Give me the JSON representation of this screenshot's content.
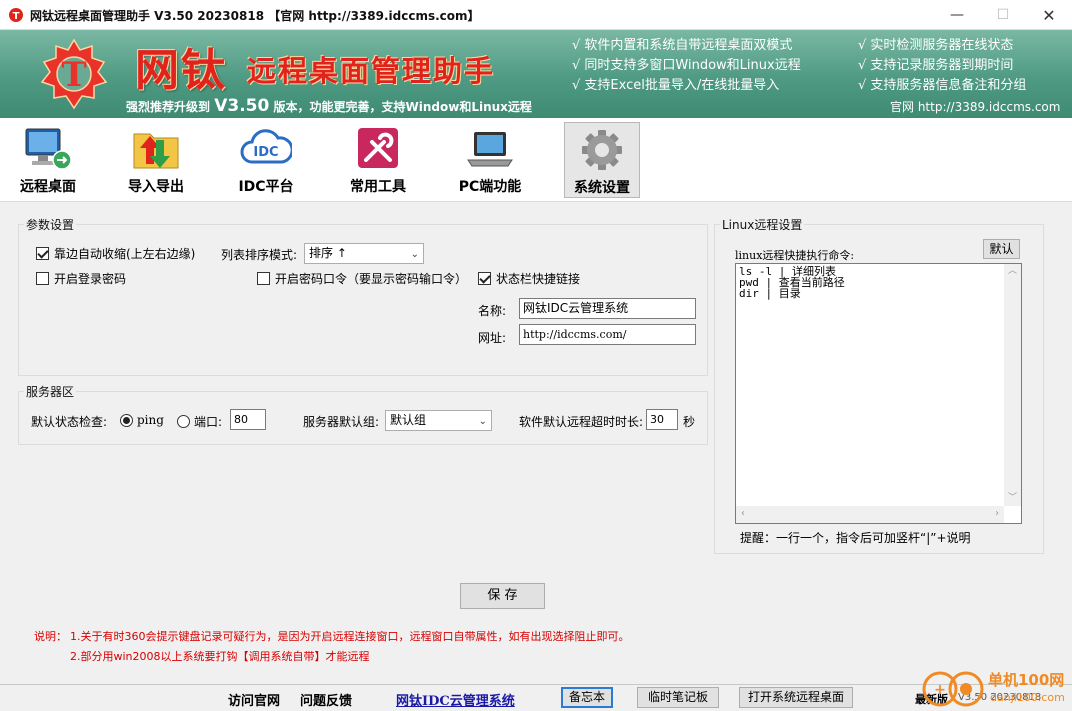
{
  "window": {
    "title": "网钛远程桌面管理助手 V3.50 20230818 【官网 http://3389.idccms.com】"
  },
  "banner": {
    "title_big": "网钛",
    "title_sub": "远程桌面管理助手",
    "promo_prefix": "强烈推荐升级到",
    "promo_version": "V3.50",
    "promo_suffix": "版本，功能更完善，支持Window和Linux远程",
    "features_left": [
      "√ 软件内置和系统自带远程桌面双模式",
      "√ 同时支持多窗口Window和Linux远程",
      "√ 支持Excel批量导入/在线批量导入"
    ],
    "features_right": [
      "√ 实时检测服务器在线状态",
      "√ 支持记录服务器到期时间",
      "√ 支持服务器信息备注和分组"
    ],
    "site": "官网  http://3389.idccms.com"
  },
  "toolbar": {
    "items": [
      {
        "label": "远程桌面",
        "icon": "remote-desktop-icon"
      },
      {
        "label": "导入导出",
        "icon": "import-export-icon"
      },
      {
        "label": "IDC平台",
        "icon": "idc-cloud-icon"
      },
      {
        "label": "常用工具",
        "icon": "tools-icon"
      },
      {
        "label": "PC端功能",
        "icon": "laptop-icon"
      },
      {
        "label": "系统设置",
        "icon": "gear-icon"
      }
    ]
  },
  "params": {
    "group_label": "参数设置",
    "auto_collapse": {
      "label": "靠边自动收缩(上左右边缘)",
      "checked": true
    },
    "sort_label": "列表排序模式:",
    "sort_value": "排序 ↑",
    "login_password": {
      "label": "开启登录密码",
      "checked": false
    },
    "password_command": {
      "label": "开启密码口令（要显示密码输口令）",
      "checked": false
    },
    "tray_shortcut": {
      "label": "状态栏快捷链接",
      "checked": true
    },
    "name_label": "名称:",
    "name_value": "网钛IDC云管理系统",
    "url_label": "网址:",
    "url_value": "http://idccms.com/"
  },
  "server": {
    "group_label": "服务器区",
    "check_label": "默认状态检查:",
    "ping_label": "ping",
    "port_label": "端口:",
    "port_value": "80",
    "default_group_label": "服务器默认组:",
    "default_group_value": "默认组",
    "timeout_label": "软件默认远程超时时长:",
    "timeout_value": "30",
    "timeout_unit": "秒"
  },
  "linux": {
    "group_label": "Linux远程设置",
    "cmd_label": "linux远程快捷执行命令:",
    "default_button": "默认",
    "commands": [
      "ls -l  | 详细列表",
      "pwd  | 查看当前路径",
      "dir  | 目录"
    ],
    "tip": "提醒：一行一个，指令后可加竖杆“|”+说明"
  },
  "save_button": "保 存",
  "notes": {
    "label": "说明：",
    "line1": "1.关于有时360会提示键盘记录可疑行为，是因为开启远程连接窗口，远程窗口自带属性，如有出现选择阻止即可。",
    "line2": "2.部分用win2008以上系统要打钩【调用系统自带】才能远程"
  },
  "status": {
    "visit_site": "访问官网",
    "feedback": "问题反馈",
    "product_link": "网钛IDC云管理系统",
    "memo_button": "备忘本",
    "notepad_button": "临时笔记板",
    "open_rdp_button": "打开系统远程桌面",
    "version_prefix": "最新版",
    "version": "V3.50 20230818"
  },
  "watermark": {
    "text": "单机100网",
    "url": "danji100.com"
  },
  "colors": {
    "banner": "#4f9a83",
    "title_red": "#e0231c",
    "note_red": "#d80000",
    "link_blue": "#1a1aa6",
    "default_button_border": "#2a7bd4"
  }
}
